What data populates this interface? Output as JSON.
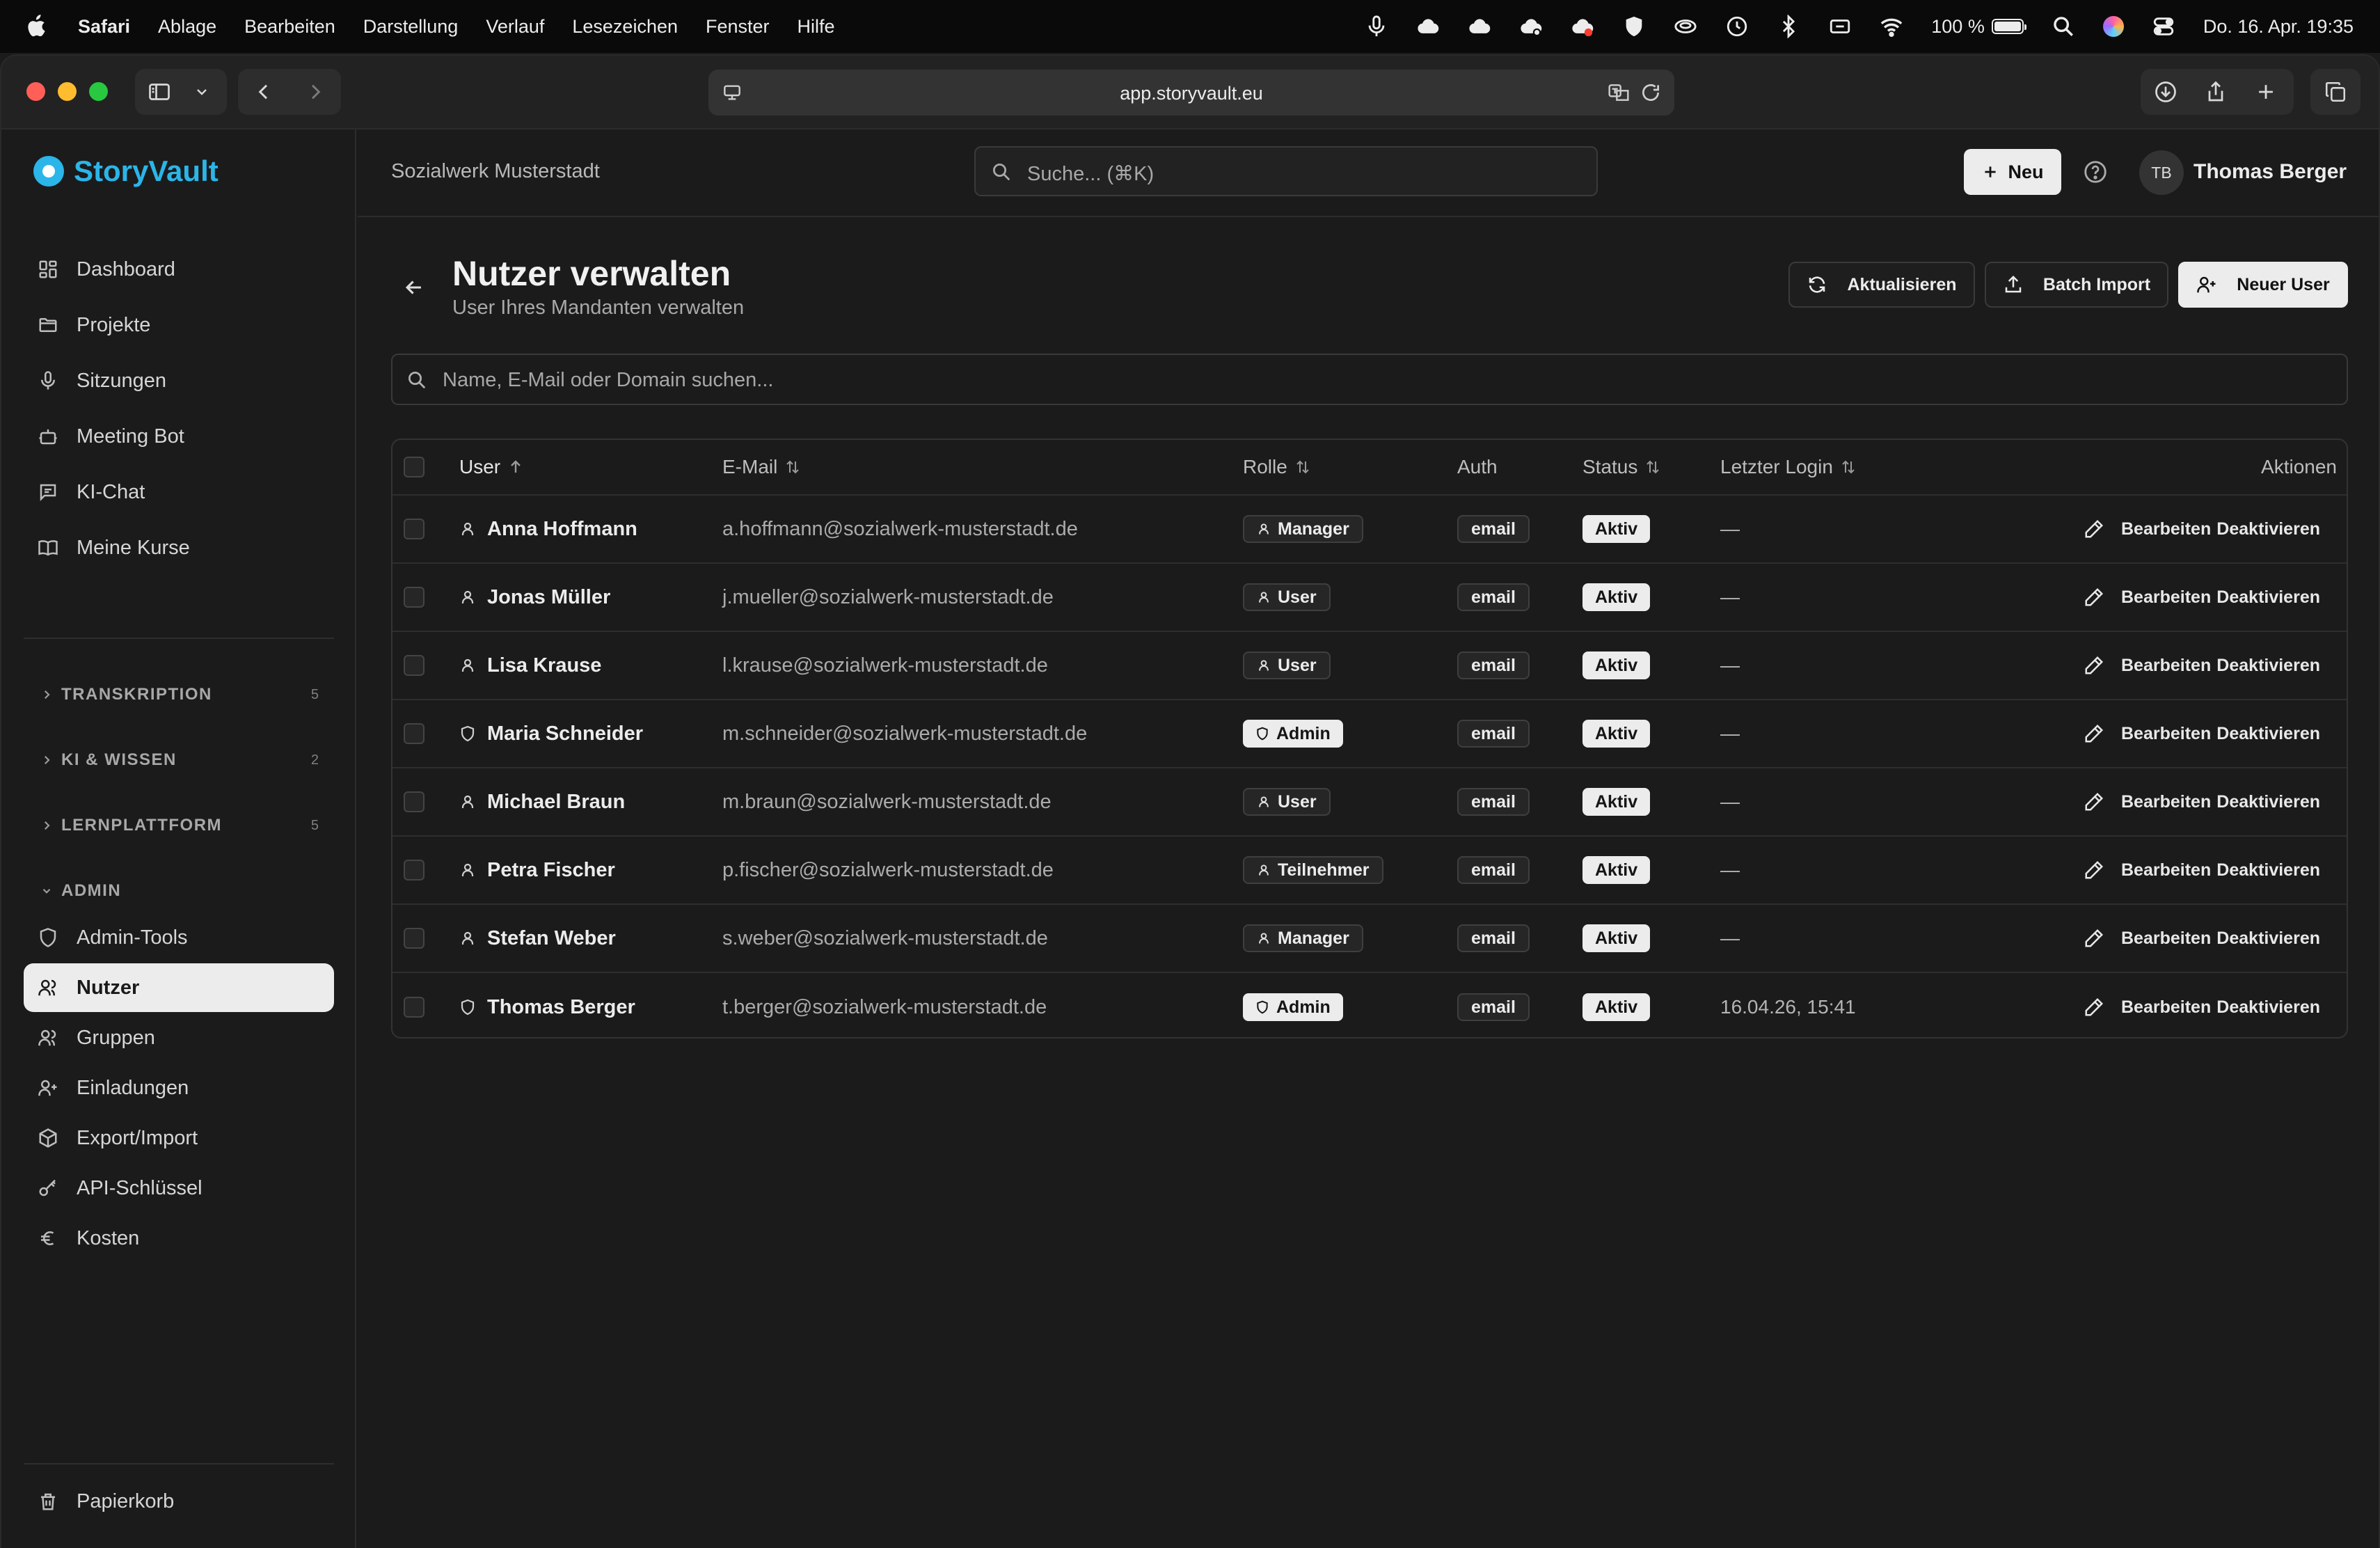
{
  "menubar": {
    "app": "Safari",
    "items": [
      "Ablage",
      "Bearbeiten",
      "Darstellung",
      "Verlauf",
      "Lesezeichen",
      "Fenster",
      "Hilfe"
    ],
    "battery": "100 %",
    "battery_level": 1.0,
    "datetime": "Do. 16. Apr.  19:35"
  },
  "browser": {
    "url": "app.storyvault.eu"
  },
  "sidebar": {
    "brand": "StoryVault",
    "nav": [
      {
        "label": "Dashboard",
        "icon": "dashboard-icon"
      },
      {
        "label": "Projekte",
        "icon": "folder-icon"
      },
      {
        "label": "Sitzungen",
        "icon": "microphone-icon"
      },
      {
        "label": "Meeting Bot",
        "icon": "bot-icon"
      },
      {
        "label": "KI-Chat",
        "icon": "chat-icon"
      },
      {
        "label": "Meine Kurse",
        "icon": "book-icon"
      }
    ],
    "sections": [
      {
        "label": "TRANSKRIPTION",
        "count": "5"
      },
      {
        "label": "KI & WISSEN",
        "count": "2"
      },
      {
        "label": "LERNPLATTFORM",
        "count": "5"
      }
    ],
    "admin": {
      "label": "ADMIN",
      "items": [
        {
          "label": "Admin-Tools",
          "icon": "shield-icon"
        },
        {
          "label": "Nutzer",
          "icon": "users-icon",
          "active": true
        },
        {
          "label": "Gruppen",
          "icon": "users-icon"
        },
        {
          "label": "Einladungen",
          "icon": "user-plus-icon"
        },
        {
          "label": "Export/Import",
          "icon": "package-icon"
        },
        {
          "label": "API-Schlüssel",
          "icon": "key-icon"
        },
        {
          "label": "Kosten",
          "icon": "euro-icon"
        }
      ]
    },
    "trash": "Papierkorb"
  },
  "topbar": {
    "organization": "Sozialwerk Musterstadt",
    "search_placeholder": "Suche... (⌘K)",
    "new_label": "Neu",
    "avatar_initials": "TB",
    "user_name": "Thomas Berger"
  },
  "page": {
    "title": "Nutzer verwalten",
    "subtitle": "User Ihres Mandanten verwalten",
    "buttons": {
      "refresh": "Aktualisieren",
      "batch_import": "Batch Import",
      "new_user": "Neuer User"
    },
    "search_placeholder": "Name, E-Mail oder Domain suchen..."
  },
  "table": {
    "columns": {
      "user": "User",
      "email": "E-Mail",
      "role": "Rolle",
      "auth": "Auth",
      "status": "Status",
      "last_login": "Letzter Login",
      "actions": "Aktionen"
    },
    "edit_label": "Bearbeiten",
    "deactivate_label": "Deaktivieren",
    "rows": [
      {
        "name": "Anna Hoffmann",
        "email": "a.hoffmann@sozialwerk-musterstadt.de",
        "role": "Manager",
        "role_kind": "outline",
        "auth": "email",
        "status": "Aktiv",
        "last_login": "—",
        "icon": "user-icon"
      },
      {
        "name": "Jonas Müller",
        "email": "j.mueller@sozialwerk-musterstadt.de",
        "role": "User",
        "role_kind": "outline",
        "auth": "email",
        "status": "Aktiv",
        "last_login": "—",
        "icon": "user-icon"
      },
      {
        "name": "Lisa Krause",
        "email": "l.krause@sozialwerk-musterstadt.de",
        "role": "User",
        "role_kind": "outline",
        "auth": "email",
        "status": "Aktiv",
        "last_login": "—",
        "icon": "user-icon"
      },
      {
        "name": "Maria Schneider",
        "email": "m.schneider@sozialwerk-musterstadt.de",
        "role": "Admin",
        "role_kind": "solid",
        "auth": "email",
        "status": "Aktiv",
        "last_login": "—",
        "icon": "shield-icon"
      },
      {
        "name": "Michael Braun",
        "email": "m.braun@sozialwerk-musterstadt.de",
        "role": "User",
        "role_kind": "outline",
        "auth": "email",
        "status": "Aktiv",
        "last_login": "—",
        "icon": "user-icon"
      },
      {
        "name": "Petra Fischer",
        "email": "p.fischer@sozialwerk-musterstadt.de",
        "role": "Teilnehmer",
        "role_kind": "outline",
        "auth": "email",
        "status": "Aktiv",
        "last_login": "—",
        "icon": "user-icon"
      },
      {
        "name": "Stefan Weber",
        "email": "s.weber@sozialwerk-musterstadt.de",
        "role": "Manager",
        "role_kind": "outline",
        "auth": "email",
        "status": "Aktiv",
        "last_login": "—",
        "icon": "user-icon"
      },
      {
        "name": "Thomas Berger",
        "email": "t.berger@sozialwerk-musterstadt.de",
        "role": "Admin",
        "role_kind": "solid",
        "auth": "email",
        "status": "Aktiv",
        "last_login": "16.04.26, 15:41",
        "icon": "shield-icon"
      }
    ]
  },
  "colors": {
    "brand": "#2bb5e8",
    "background": "#1b1b1b",
    "traffic_red": "#ff5f57",
    "traffic_yellow": "#febc2e",
    "traffic_green": "#28c840"
  }
}
